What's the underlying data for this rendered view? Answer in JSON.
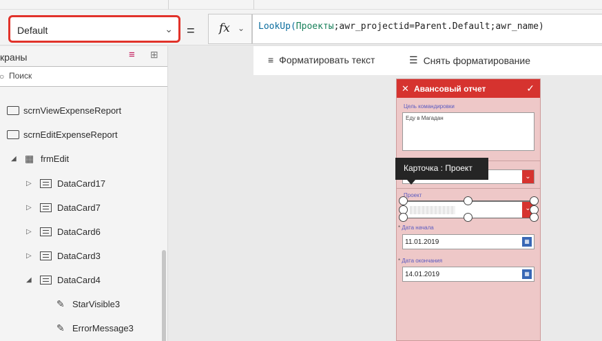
{
  "property_selector": {
    "value": "Default"
  },
  "formula_bar": {
    "equals": "=",
    "fx_label": "fx",
    "formula": {
      "fn": "LookUp(",
      "source": "Проекты",
      "rest": ";awr_projectid=Parent.Default;awr_name)"
    }
  },
  "tree_panel": {
    "title": "краны",
    "search_placeholder": "Поиск",
    "items": [
      {
        "label": "scrnViewExpenseReport",
        "type": "screen"
      },
      {
        "label": "scrnEditExpenseReport",
        "type": "screen"
      },
      {
        "label": "frmEdit",
        "type": "form"
      },
      {
        "label": "DataCard17",
        "type": "card"
      },
      {
        "label": "DataCard7",
        "type": "card"
      },
      {
        "label": "DataCard6",
        "type": "card"
      },
      {
        "label": "DataCard3",
        "type": "card"
      },
      {
        "label": "DataCard4",
        "type": "card"
      },
      {
        "label": "StarVisible3",
        "type": "control"
      },
      {
        "label": "ErrorMessage3",
        "type": "control"
      }
    ]
  },
  "toolbar": {
    "format_text": "Форматировать текст",
    "clear_format": "Снять форматирование"
  },
  "phone_preview": {
    "title": "Авансовый отчет",
    "purpose_label": "Цель командировки",
    "purpose_value": "Еду в Магадан",
    "project_label": "Проект",
    "start_label": "Дата начала",
    "start_value": "11.01.2019",
    "end_label": "Дата окончания",
    "end_value": "14.01.2019",
    "required_mark": "*"
  },
  "tooltip": "Карточка : Проект",
  "colors": {
    "highlight": "#e1322a",
    "header_red": "#d6332f",
    "calendar_blue": "#3867b5",
    "card_bg": "#eec8c8"
  }
}
